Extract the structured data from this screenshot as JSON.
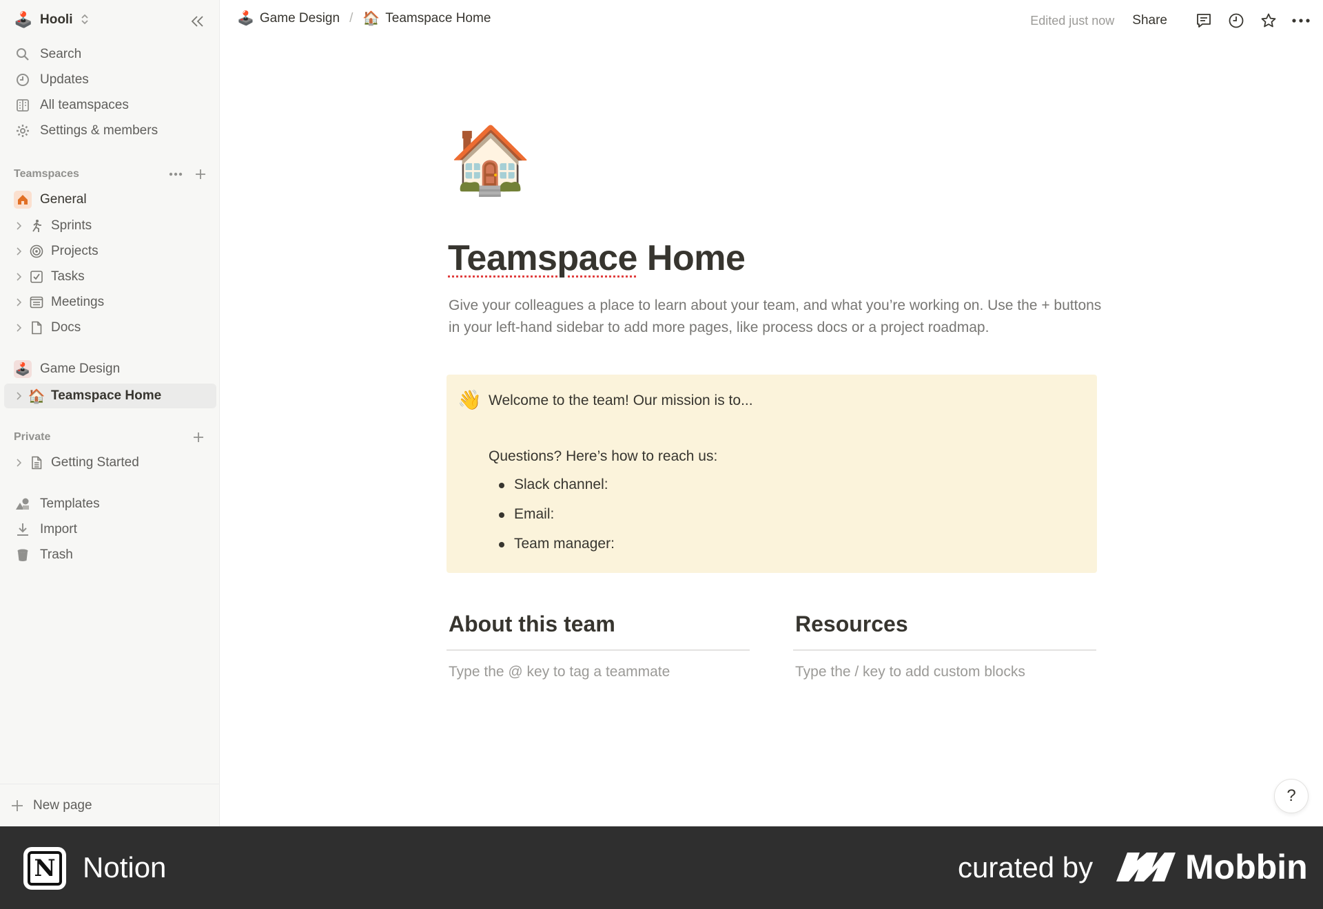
{
  "workspace": {
    "name": "Hooli"
  },
  "sidebar": {
    "nav": [
      {
        "label": "Search",
        "icon": "search-icon"
      },
      {
        "label": "Updates",
        "icon": "clock-icon"
      },
      {
        "label": "All teamspaces",
        "icon": "building-icon"
      },
      {
        "label": "Settings & members",
        "icon": "gear-icon"
      }
    ],
    "teamspaces_label": "Teamspaces",
    "general_label": "General",
    "general_items": [
      {
        "label": "Sprints",
        "icon": "runner-icon"
      },
      {
        "label": "Projects",
        "icon": "target-icon"
      },
      {
        "label": "Tasks",
        "icon": "checkbox-icon"
      },
      {
        "label": "Meetings",
        "icon": "notes-icon"
      },
      {
        "label": "Docs",
        "icon": "document-icon"
      }
    ],
    "game_design_label": "Game Design",
    "teamspace_home_label": "Teamspace Home",
    "private_label": "Private",
    "private_items": [
      {
        "label": "Getting Started",
        "icon": "document-icon"
      }
    ],
    "footer_items": [
      {
        "label": "Templates",
        "icon": "templates-icon"
      },
      {
        "label": "Import",
        "icon": "download-icon"
      },
      {
        "label": "Trash",
        "icon": "trash-icon"
      }
    ],
    "new_page_label": "New page"
  },
  "topbar": {
    "crumb_1": "Game Design",
    "crumb_2": "Teamspace Home",
    "separator": "/",
    "edited": "Edited just now",
    "share": "Share"
  },
  "page": {
    "title_part1": "Teamspace",
    "title_part2": "Home",
    "description": "Give your colleagues a place to learn about your team, and what you’re working on. Use the + buttons in your left-hand sidebar to add more pages, like process docs or a project roadmap.",
    "callout": {
      "lead": "Welcome to the team! Our mission is to...",
      "question": "Questions? Here’s how to reach us:",
      "items": [
        "Slack channel:",
        "Email:",
        "Team manager:"
      ]
    },
    "about_heading": "About this team",
    "about_hint": "Type the @ key to tag a teammate",
    "resources_heading": "Resources",
    "resources_hint": "Type the / key to add custom blocks"
  },
  "help": "?",
  "banner": {
    "app": "Notion",
    "curated": "curated by",
    "brand": "Mobbin"
  }
}
